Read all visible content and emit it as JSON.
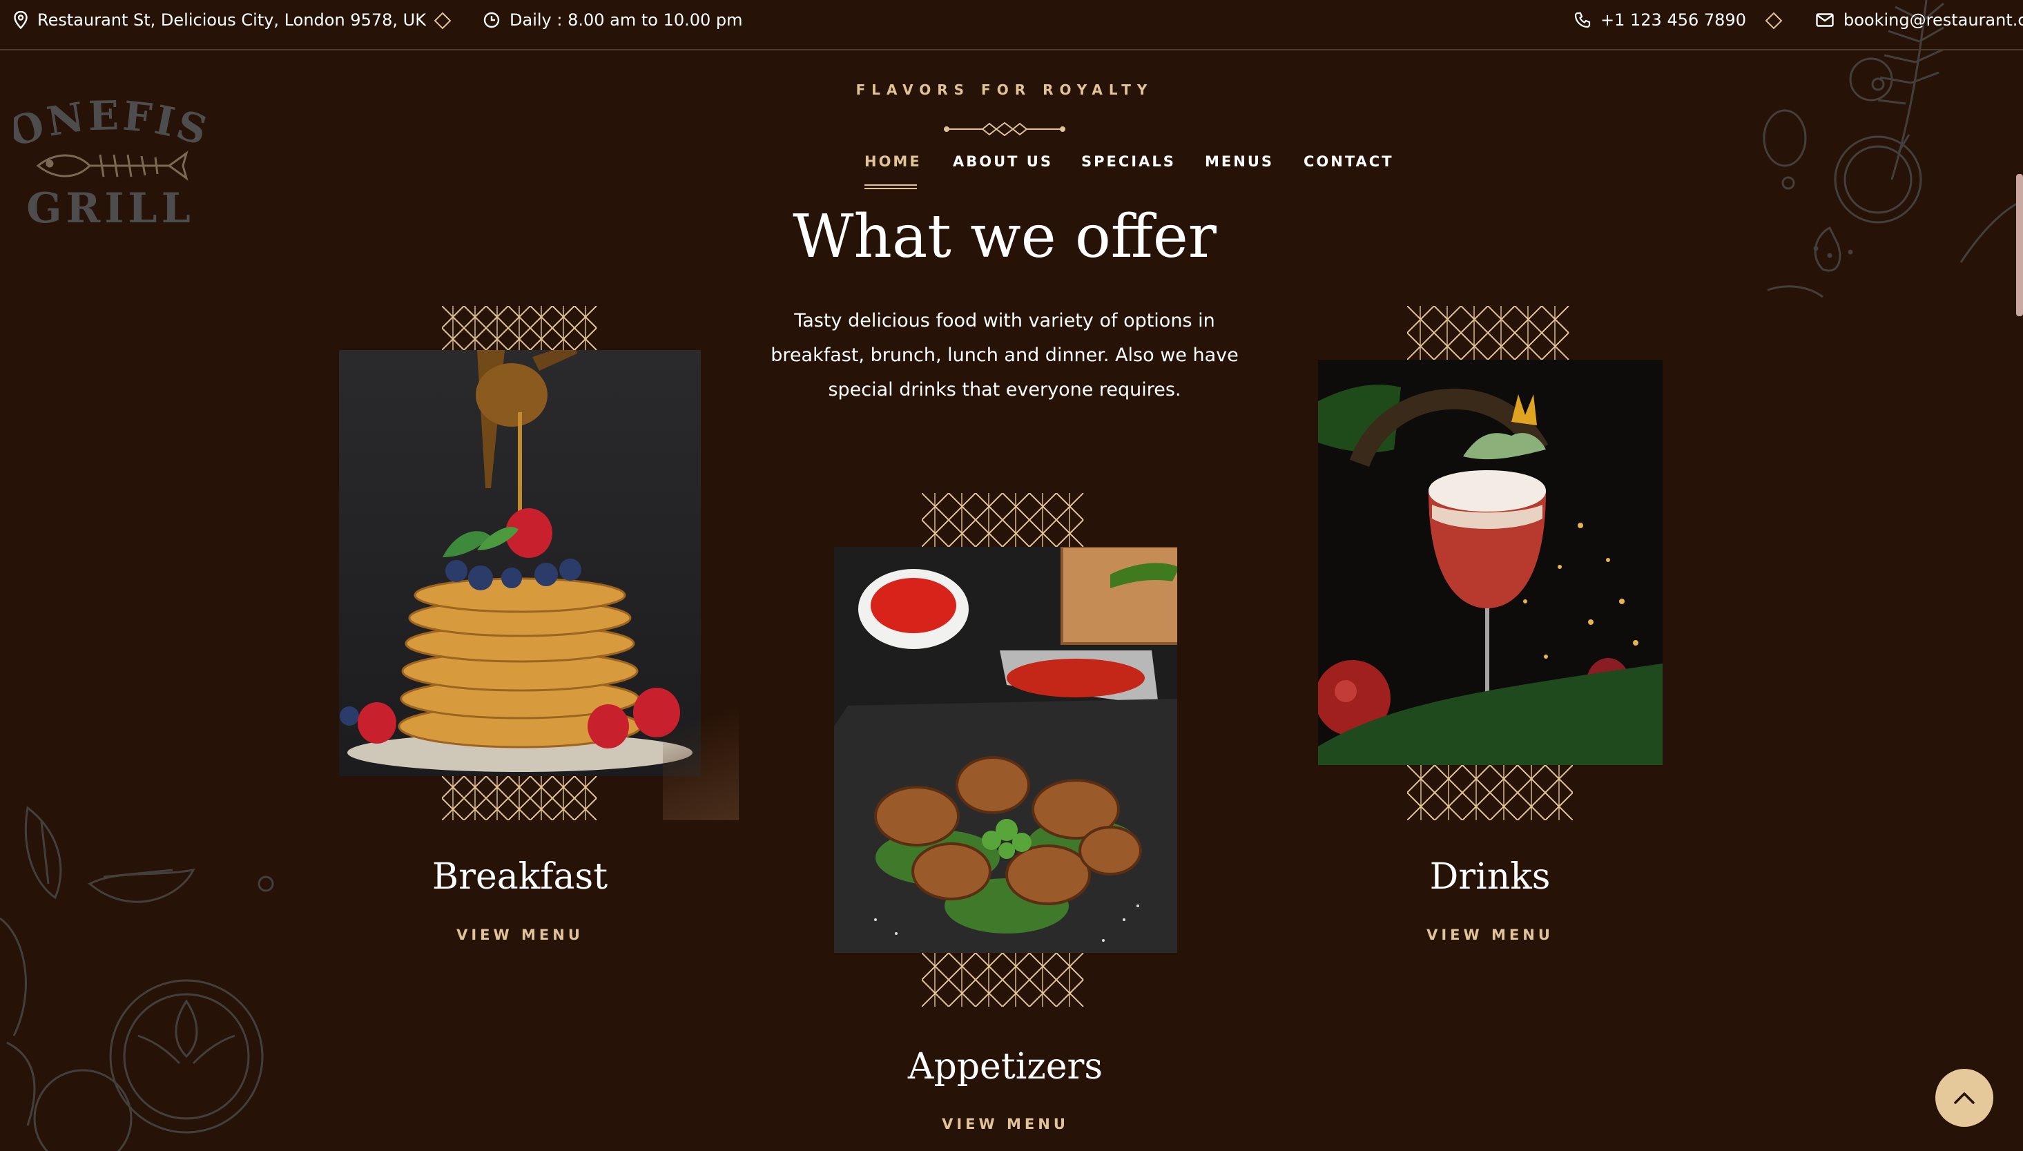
{
  "topbar": {
    "address": "Restaurant St, Delicious City, London 9578, UK",
    "hours": "Daily : 8.00 am to 10.00 pm",
    "phone": "+1 123 456 7890",
    "email": "booking@restaurant.co"
  },
  "brand": {
    "logo_text_top": "BONEFISH",
    "logo_text_bottom": "GRILL",
    "tagline": "FLAVORS FOR ROYALTY"
  },
  "nav": {
    "items": [
      {
        "label": "HOME",
        "active": true
      },
      {
        "label": "ABOUT US"
      },
      {
        "label": "SPECIALS"
      },
      {
        "label": "MENUS"
      },
      {
        "label": "CONTACT"
      }
    ]
  },
  "section": {
    "heading": "What we offer",
    "description": "Tasty delicious food with variety of options in breakfast, brunch, lunch and dinner. Also we have special drinks that everyone requires."
  },
  "cards": [
    {
      "title": "Breakfast",
      "link": "VIEW MENU",
      "image": "pancakes-with-honey-and-berries"
    },
    {
      "title": "Appetizers",
      "link": "VIEW MENU",
      "image": "grilled-chicken-wings"
    },
    {
      "title": "Drinks",
      "link": "VIEW MENU",
      "image": "red-cocktail-glass"
    }
  ],
  "colors": {
    "background": "#261206",
    "accent": "#e0c396",
    "button": "#e6c99b"
  }
}
